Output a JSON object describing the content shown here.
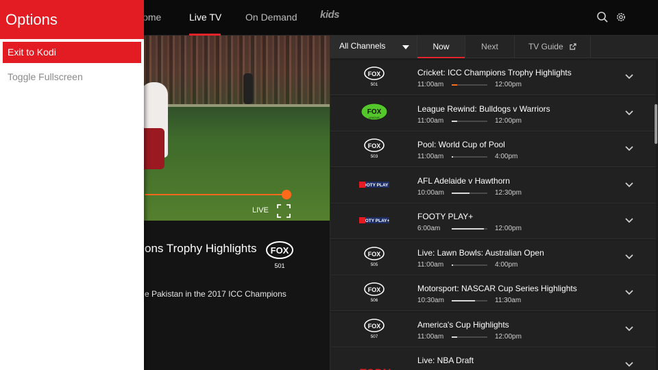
{
  "nav": {
    "items": [
      {
        "label": "Home"
      },
      {
        "label": "Live TV"
      },
      {
        "label": "On Demand"
      },
      {
        "label": "kids"
      }
    ],
    "search_icon": "search-icon",
    "settings_icon": "gear-icon"
  },
  "player": {
    "live_label": "LIVE",
    "progress": 1.0
  },
  "program": {
    "title_visible": "ons Trophy Highlights",
    "description_visible": "e Pakistan in the 2017 ICC Champions",
    "channel_logo_text": "FOX",
    "channel_number": "501"
  },
  "filter": {
    "selected": "All Channels",
    "tabs": [
      {
        "label": "Now"
      },
      {
        "label": "Next"
      },
      {
        "label": "TV Guide"
      }
    ]
  },
  "channels": [
    {
      "logo": "fox-sports-501",
      "logo_text": "FOX",
      "logo_sub": "501",
      "title": "Cricket: ICC Champions Trophy Highlights",
      "start": "11:00am",
      "end": "12:00pm",
      "progress": 0.15,
      "hot": true
    },
    {
      "logo": "fox-league",
      "logo_text": "FOX",
      "logo_sub": "LEAGUE",
      "title": "League Rewind: Bulldogs v Warriors",
      "start": "11:00am",
      "end": "12:00pm",
      "progress": 0.15,
      "hot": false
    },
    {
      "logo": "fox-sports-503",
      "logo_text": "FOX",
      "logo_sub": "503",
      "title": "Pool: World Cup of Pool",
      "start": "11:00am",
      "end": "4:00pm",
      "progress": 0.03,
      "hot": false
    },
    {
      "logo": "footy-play",
      "logo_text": "FOOTY PLAY",
      "logo_sub": "",
      "title": "AFL Adelaide v Hawthorn",
      "start": "10:00am",
      "end": "12:30pm",
      "progress": 0.5,
      "hot": false
    },
    {
      "logo": "footy-play-plus",
      "logo_text": "FOOTY PLAY+",
      "logo_sub": "",
      "title": "FOOTY PLAY+",
      "start": "6:00am",
      "end": "12:00pm",
      "progress": 0.9,
      "hot": false
    },
    {
      "logo": "fox-sports-505",
      "logo_text": "FOX",
      "logo_sub": "505",
      "title": "Live: Lawn Bowls: Australian Open",
      "start": "11:00am",
      "end": "4:00pm",
      "progress": 0.03,
      "hot": false
    },
    {
      "logo": "fox-sports-506",
      "logo_text": "FOX",
      "logo_sub": "506",
      "title": "Motorsport: NASCAR Cup Series Highlights",
      "start": "10:30am",
      "end": "11:30am",
      "progress": 0.65,
      "hot": false
    },
    {
      "logo": "fox-more-507",
      "logo_text": "FOX",
      "logo_sub": "507",
      "title": "America's Cup Highlights",
      "start": "11:00am",
      "end": "12:00pm",
      "progress": 0.15,
      "hot": false
    },
    {
      "logo": "espn",
      "logo_text": "ESPN",
      "logo_sub": "",
      "title": "Live: NBA Draft",
      "start": "",
      "end": "",
      "progress": 0.0,
      "hot": false
    }
  ],
  "options_menu": {
    "title": "Options",
    "items": [
      {
        "label": "Exit to Kodi",
        "selected": true
      },
      {
        "label": "Toggle Fullscreen",
        "selected": false
      }
    ]
  },
  "colors": {
    "accent_red": "#e31b23",
    "progress_orange": "#ff6a1a",
    "fox_league_green": "#54c82a"
  }
}
